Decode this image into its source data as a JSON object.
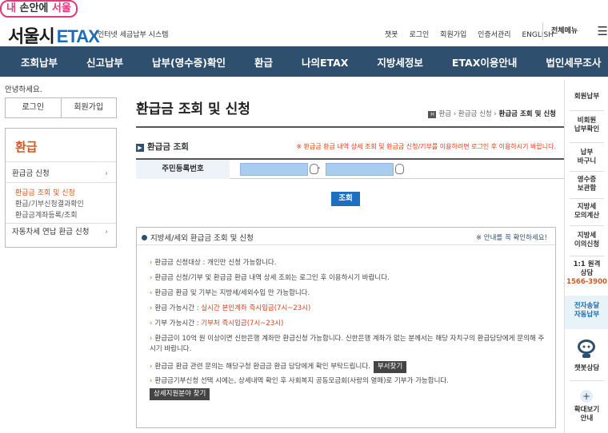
{
  "tag": {
    "pre": "내 ",
    "bold": "손안에",
    "post": " 서울"
  },
  "logo": {
    "seoul": "서울시",
    "etax": "ETAX",
    "sub": "인터넷 세금납부 시스템"
  },
  "util": [
    "챗봇",
    "로그인",
    "회원가입",
    "인증서관리",
    "ENGLISH"
  ],
  "allmenu": {
    "label": "전체메뉴",
    "icon": "menu-icon"
  },
  "gnb": [
    "조회납부",
    "신고납부",
    "납부(영수증)확인",
    "환급",
    "나의ETAX",
    "지방세정보",
    "ETAX이용안내",
    "법인세무조사"
  ],
  "left": {
    "hello": "안녕하세요.",
    "login": "로그인",
    "join": "회원가입",
    "lnb_title": "환급",
    "items": [
      {
        "label": "환급금 신청",
        "chev": "›"
      },
      {
        "label": "환급금 조회 및 신청"
      },
      {
        "label": "환급/기부신청결과확인"
      },
      {
        "label": "환급금계좌등록/조회"
      },
      {
        "label": "자동차세 연납 환급 신청",
        "chev": "›"
      }
    ]
  },
  "main": {
    "title": "환급금 조회 및 신청",
    "bread": {
      "home": "H",
      "b1": "환급",
      "b2": "환급금 신청",
      "cur": "환급금 조회 및 신청"
    },
    "section": "환급금 조회",
    "notice": "※ 환급금 환급 내역 상세 조회 및 환급금 신청/기부를 이용하려면 로그인 후 이용하시기 바랍니다.",
    "form_label": "주민등록번호",
    "dash": "-",
    "search_btn": "조회",
    "box_title": "지방세/세외 환급금 조회 및 신청",
    "box_right": "※ 안내를 꼭 확인하세요!",
    "bullets": [
      {
        "a": "환급금 신청대상 : 개인만 신청 가능합니다."
      },
      {
        "a": "환급금 신청/기부 및 환급금 환급 내역 상세 조회는 로그인 후 이용하시기 바랍니다."
      },
      {
        "a": "환급금 환급 및 기부는 지방세/세외수입 만 가능합니다."
      },
      {
        "a": "환급 가능시간 : ",
        "red": "실시간 본인계좌 즉시입금(7시~23시)"
      },
      {
        "a": "기부 가능시간 : ",
        "red": "기부처 즉시입금(7시~23시)"
      },
      {
        "a": "환급금이 10억 원 이상이면 신한은행 계좌만 환급신청 가능합니다. 신한은행 계좌가 없는 분께서는 해당 자치구의 환급담당에게 문의해 주시기 바랍니다."
      },
      {
        "a": "환급금 환급 관련 문의는 해당구청 환급금 환급 담당에게 확인 부탁드립니다.",
        "btn": "부서찾기"
      },
      {
        "a": "환급금기부신청 선택 시에는, 상세내역 확인 후 사회복지 공동모금회(사랑의 열매)로 기부가 가능합니다.",
        "btn2": "상세지원분야 찾기"
      }
    ]
  },
  "right": {
    "q1": "회원납부",
    "q2a": "비회원",
    "q2b": "납부확인",
    "q3a": "납부",
    "q3b": "바구니",
    "q4a": "영수증",
    "q4b": "보관함",
    "q5a": "지방세",
    "q5b": "모의계산",
    "q6a": "지방세",
    "q6b": "이의신청",
    "q7a": "1:1 원격",
    "q7b": "상담",
    "q7c": "1566-3900",
    "q8a": "전자송달",
    "q8b": "자동납부",
    "q9": "챗봇상담",
    "q10a": "확대보기",
    "q10b": "안내"
  }
}
